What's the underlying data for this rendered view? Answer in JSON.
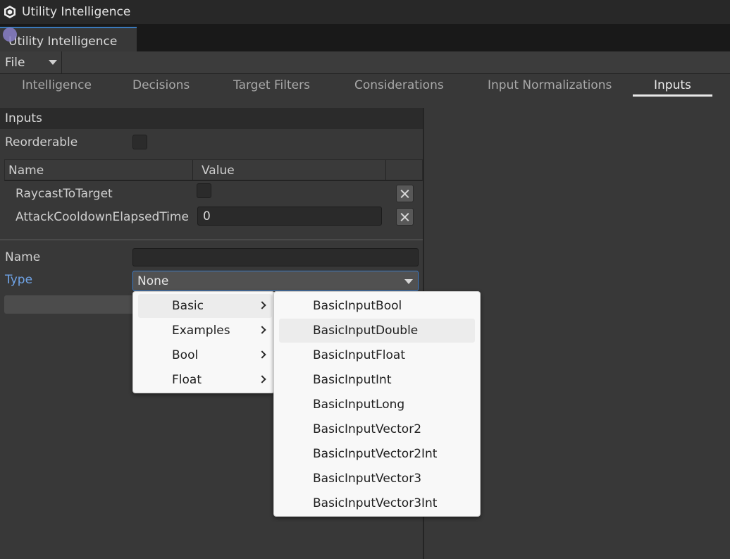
{
  "window": {
    "title": "Utility Intelligence",
    "tab_label": "Utility Intelligence"
  },
  "toolbar": {
    "file_label": "File"
  },
  "navtabs": [
    {
      "label": "Intelligence"
    },
    {
      "label": "Decisions"
    },
    {
      "label": "Target Filters"
    },
    {
      "label": "Considerations"
    },
    {
      "label": "Input Normalizations"
    },
    {
      "label": "Inputs",
      "active": true
    }
  ],
  "inputs_panel": {
    "header": "Inputs",
    "reorderable_label": "Reorderable",
    "reorderable_checked": false,
    "columns": {
      "name": "Name",
      "value": "Value"
    },
    "rows": [
      {
        "name": "RaycastToTarget",
        "value_type": "checkbox",
        "checked": false
      },
      {
        "name": "AttackCooldownElapsedTime",
        "value_type": "text",
        "value": "0"
      }
    ],
    "form": {
      "name_label": "Name",
      "name_value": "",
      "type_label": "Type",
      "type_value": "None"
    }
  },
  "type_menu": {
    "categories": [
      {
        "label": "Basic",
        "highlighted": true
      },
      {
        "label": "Examples"
      },
      {
        "label": "Bool"
      },
      {
        "label": "Float"
      }
    ],
    "submenu_items": [
      {
        "label": "BasicInputBool"
      },
      {
        "label": "BasicInputDouble",
        "highlighted": true
      },
      {
        "label": "BasicInputFloat"
      },
      {
        "label": "BasicInputInt"
      },
      {
        "label": "BasicInputLong"
      },
      {
        "label": "BasicInputVector2"
      },
      {
        "label": "BasicInputVector2Int"
      },
      {
        "label": "BasicInputVector3"
      },
      {
        "label": "BasicInputVector3Int"
      }
    ]
  },
  "colors": {
    "accent": "#3a79bb",
    "type_label": "#6fa3e6",
    "menu_bg": "#f8f8f8"
  }
}
